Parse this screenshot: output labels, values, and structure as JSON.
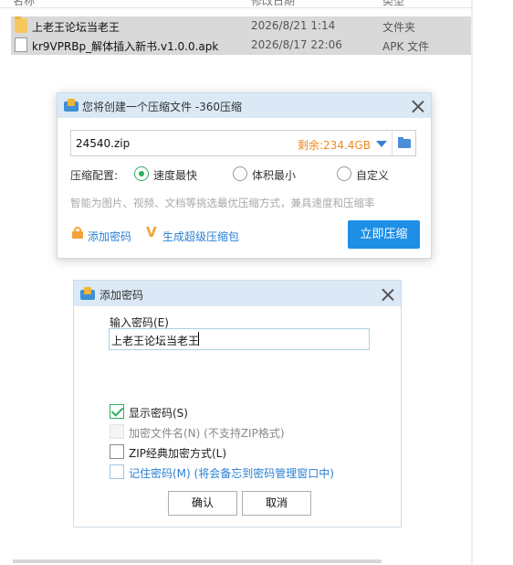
{
  "explorer": {
    "columns": [
      "名称",
      "修改日期",
      "类型"
    ],
    "files": [
      {
        "name": "上老王论坛当老王",
        "date": "2026/8/21 1:14",
        "type": "文件夹",
        "icon": "folder-icon"
      },
      {
        "name": "kr9VPRBp_解体插入新书.v1.0.0.apk",
        "date": "2026/8/17 22:06",
        "type": "APK 文件",
        "icon": "file-icon"
      }
    ]
  },
  "compress_dialog": {
    "title": "您将创建一个压缩文件 -360压缩",
    "filename": "24540.zip",
    "free_space": "剩余:234.4GB",
    "config_label": "压缩配置:",
    "options": [
      {
        "label": "速度最快",
        "selected": true
      },
      {
        "label": "体积最小",
        "selected": false
      },
      {
        "label": "自定义",
        "selected": false
      }
    ],
    "hint": "智能为图片、视频、文档等挑选最优压缩方式，兼具速度和压缩率",
    "add_password": "添加密码",
    "super_package": "生成超级压缩包",
    "compress_button": "立即压缩",
    "accent_color": "#1f8fe6"
  },
  "password_dialog": {
    "title": "添加密码",
    "input_label": "输入密码(E)",
    "password_value": "上老王论坛当老王",
    "checkboxes": [
      {
        "label": "显示密码(S)",
        "checked": true,
        "enabled": true
      },
      {
        "label": "加密文件名(N) (不支持ZIP格式)",
        "checked": false,
        "enabled": false
      },
      {
        "label": "ZIP经典加密方式(L)",
        "checked": false,
        "enabled": true
      },
      {
        "label": "记住密码(M) (将会备忘到密码管理窗口中)",
        "checked": false,
        "enabled": true
      }
    ],
    "ok_label": "确认",
    "cancel_label": "取消"
  }
}
